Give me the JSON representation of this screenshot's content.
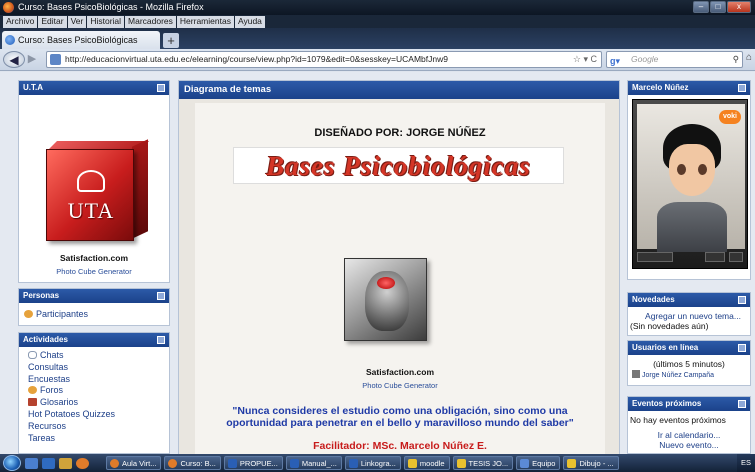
{
  "window": {
    "title": "Curso: Bases PsicoBiológicas - Mozilla Firefox",
    "controls": [
      "–",
      "□",
      "x"
    ]
  },
  "menu": [
    "Archivo",
    "Editar",
    "Ver",
    "Historial",
    "Marcadores",
    "Herramientas",
    "Ayuda"
  ],
  "tab": {
    "label": "Curso: Bases PsicoBiológicas",
    "new_tab_symbol": "+"
  },
  "nav": {
    "url": "http://educacionvirtual.uta.edu.ec/elearning/course/view.php?id=1079&edit=0&sesskey=UCAMbfJnw9",
    "search_placeholder": "Google"
  },
  "left": {
    "uta_block": {
      "title": "U.T.A",
      "cube_text": "UTA",
      "credit": "Satisfaction.com",
      "generator_link": "Photo Cube Generator"
    },
    "personas_block": {
      "title": "Personas",
      "items": [
        "Participantes"
      ]
    },
    "actividades_block": {
      "title": "Actividades",
      "items": [
        "Chats",
        "Consultas",
        "Encuestas",
        "Foros",
        "Glosarios",
        "Hot Potatoes Quizzes",
        "Recursos",
        "Tareas"
      ]
    }
  },
  "center": {
    "header": "Diagrama de temas",
    "designed_by": "DISEÑADO POR: JORGE NÚÑEZ",
    "banner": "Bases Psicobiológicas",
    "credit": "Satisfaction.com",
    "generator_link": "Photo Cube Generator",
    "quote": "\"Nunca consideres el estudio como una obligación, sino como una oportunidad para penetrar en el bello y maravilloso mundo del saber\"",
    "facilitator": "Facilitador: MSc. Marcelo Núñez E."
  },
  "right": {
    "avatar_block": {
      "title": "Marcelo Núñez",
      "badge": "voki"
    },
    "novedades_block": {
      "title": "Novedades",
      "link": "Agregar un nuevo tema...",
      "note": "(Sin novedades aún)"
    },
    "usuarios_block": {
      "title": "Usuarios en línea",
      "note": "(últimos 5 minutos)",
      "user": "Jorge Núñez Campaña"
    },
    "eventos_block": {
      "title": "Eventos próximos",
      "note": "No hay eventos próximos",
      "link_calendar": "Ir al calendario...",
      "link_new": "Nuevo evento..."
    }
  },
  "taskbar": {
    "tasks": [
      "Aula Virt...",
      "Curso: B...",
      "PROPUE...",
      "Manual_...",
      "Linkogra...",
      "moodle",
      "TESIS JO...",
      "Equipo",
      "Dibujo - ..."
    ],
    "tray": "ES"
  },
  "colors": {
    "block_header": "#1b428a",
    "quote": "#1f3aa6",
    "facilitator": "#c71b1b",
    "banner": "#d43526"
  }
}
